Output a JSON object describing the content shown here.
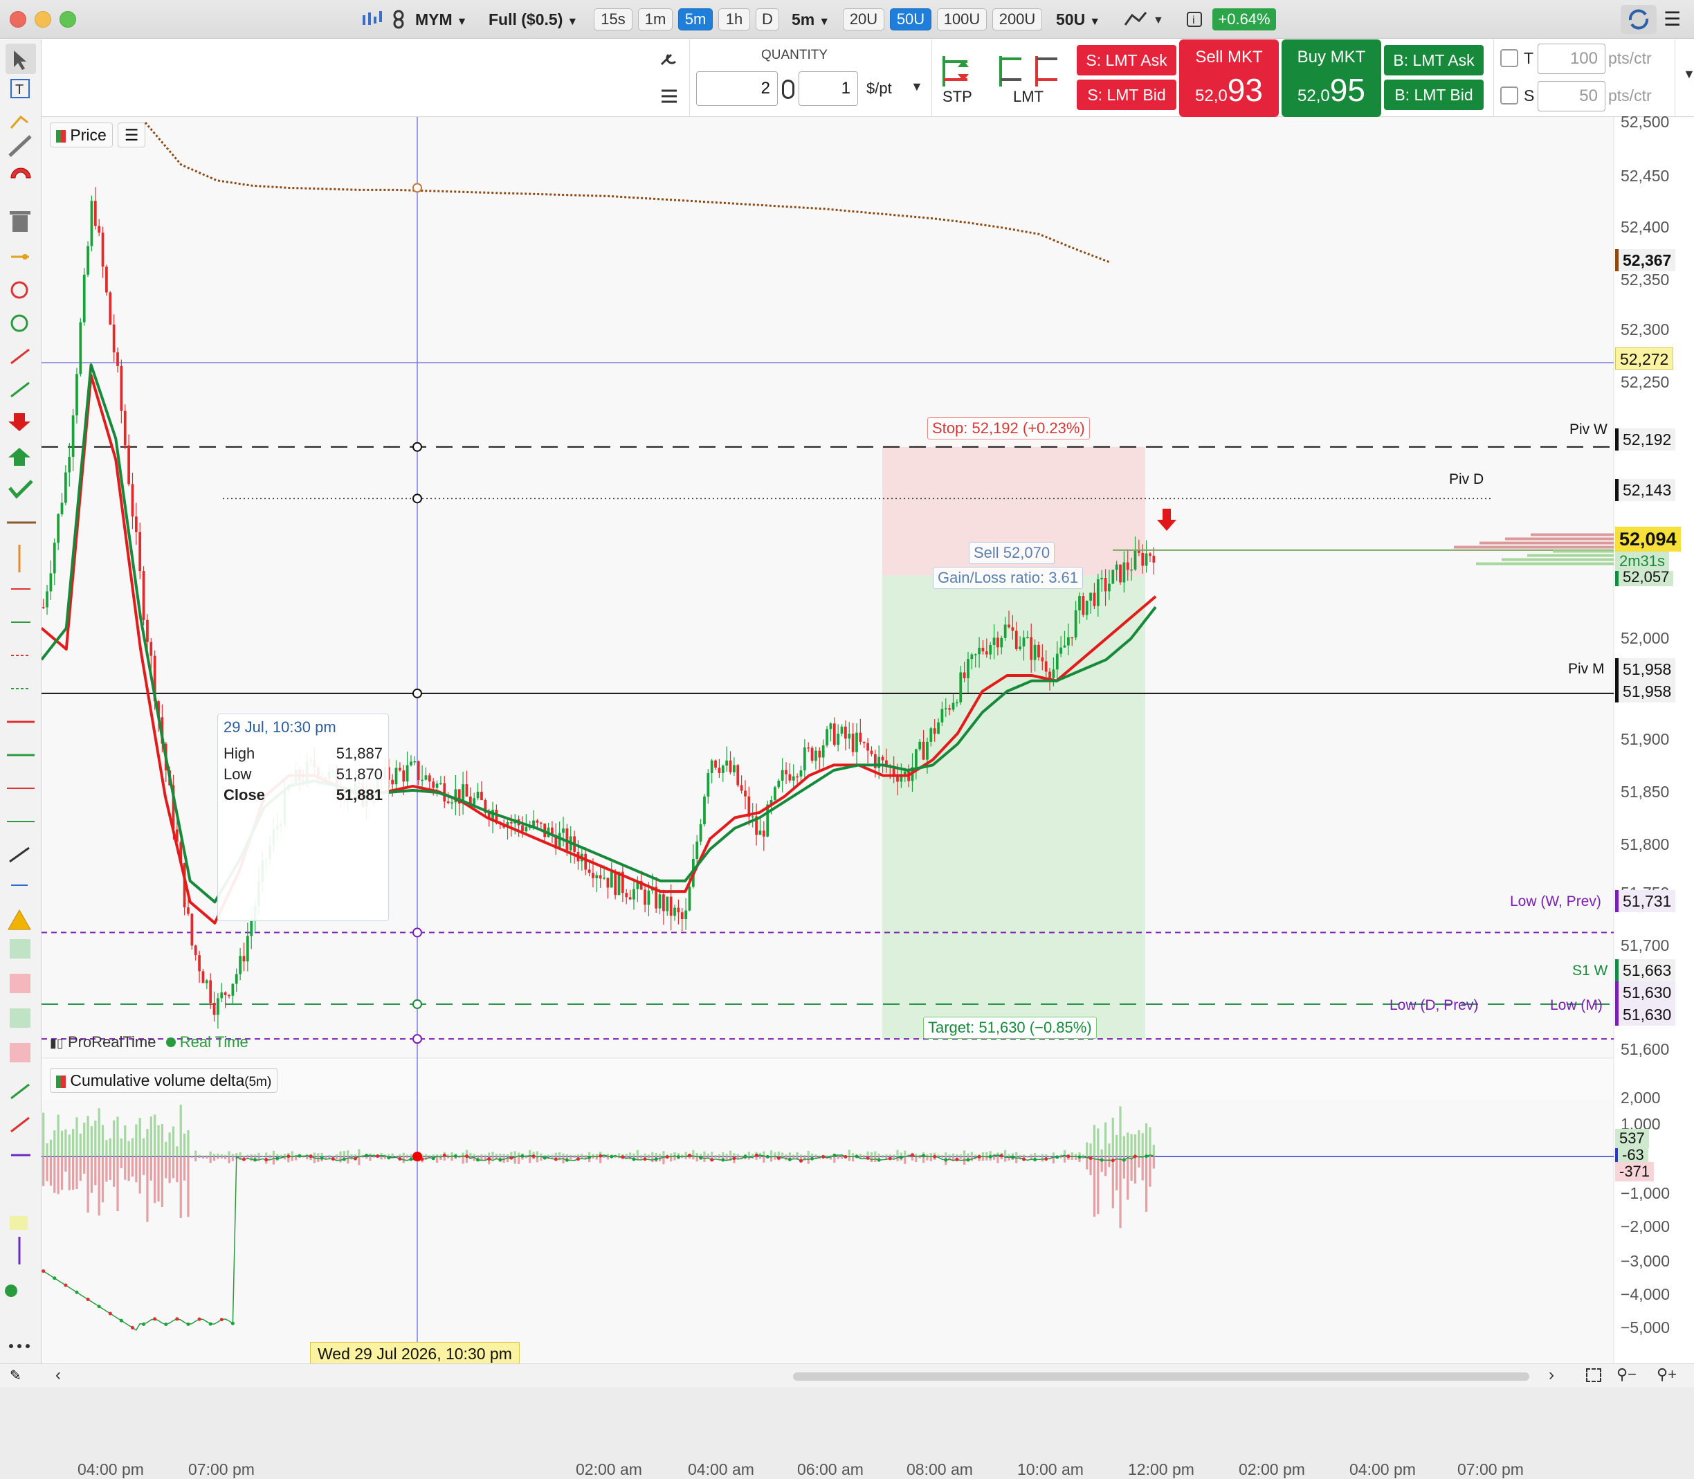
{
  "titlebar": {
    "symbol": "MYM",
    "contract": "Full ($0.5)",
    "timeframes": [
      {
        "label": "15s",
        "active": false
      },
      {
        "label": "1m",
        "active": false
      },
      {
        "label": "5m",
        "active": true
      },
      {
        "label": "1h",
        "active": false
      },
      {
        "label": "D",
        "active": false
      }
    ],
    "period_select": "5m",
    "units": [
      {
        "label": "20U",
        "active": false
      },
      {
        "label": "50U",
        "active": true
      },
      {
        "label": "100U",
        "active": false
      },
      {
        "label": "200U",
        "active": false
      }
    ],
    "units_select": "50U",
    "change": "+0.64%",
    "colors": {
      "change_bg": "#2ca44a",
      "active": "#1f7ed9"
    }
  },
  "orderbar": {
    "quantity_label": "QUANTITY",
    "qty_left": "2",
    "qty_right": "1",
    "per_point": "$/pt",
    "stp_label": "STP",
    "lmt_label": "LMT",
    "s_lmt_ask": "S: LMT Ask",
    "s_lmt_bid": "S: LMT Bid",
    "sell_mkt": "Sell MKT",
    "sell_prefix": "52,0",
    "sell_big": "93",
    "buy_mkt": "Buy MKT",
    "buy_prefix": "52,0",
    "buy_big": "95",
    "b_lmt_ask": "B: LMT Ask",
    "b_lmt_bid": "B: LMT Bid",
    "t_label": "T",
    "t_value": "100",
    "t_unit": "pts/ctr",
    "s_label": "S",
    "s_value": "50",
    "s_unit": "pts/ctr"
  },
  "chart": {
    "price_btn": "Price",
    "source": "ProRealTime",
    "realtime": "Real Time",
    "indicator": "Cumulative volume delta",
    "indicator_period": "(5m)",
    "tooltip": {
      "date": "29 Jul, 10:30 pm",
      "high_label": "High",
      "high": "51,887",
      "low_label": "Low",
      "low": "51,870",
      "close_label": "Close",
      "close": "51,881"
    },
    "stop_label": "Stop: 52,192 (+0.23%)",
    "target_label": "Target: 51,630 (−0.85%)",
    "sell_label": "Sell 52,070",
    "gain_loss": "Gain/Loss ratio: 3.61",
    "countdown": "2m31s",
    "crosshair_date": "Wed 29 Jul 2026, 10:30 pm",
    "levels": {
      "piv_w": "Piv W",
      "piv_d": "Piv D",
      "piv_m": "Piv M",
      "low_w_prev": "Low (W, Prev)",
      "s1_w": "S1 W",
      "low_d_prev": "Low (D, Prev)",
      "low_m": "Low (M)"
    },
    "price_axis": [
      "52,500",
      "52,450",
      "52,400",
      "52,350",
      "52,300",
      "52,250",
      "52,000",
      "51,900",
      "51,850",
      "51,800",
      "51,750",
      "51,700",
      "51,600"
    ],
    "price_tags": {
      "p52367": "52,367",
      "p52272": "52,272",
      "p52192": "52,192",
      "p52143": "52,143",
      "p52094": "52,094",
      "p52057": "52,057",
      "p51958a": "51,958",
      "p51958b": "51,958",
      "p51731": "51,731",
      "p51663": "51,663",
      "p51630a": "51,630",
      "p51630b": "51,630"
    },
    "cvd_axis": [
      "2,000",
      "1,000",
      "−1,000",
      "−2,000",
      "−3,000",
      "−4,000",
      "−5,000"
    ],
    "cvd_tags": {
      "a": "537",
      "b": "-63",
      "c": "-371"
    },
    "time_axis": [
      "04:00 pm",
      "07:00 pm",
      "02:00 am",
      "04:00 am",
      "06:00 am",
      "08:00 am",
      "10:00 am",
      "12:00 pm",
      "02:00 pm",
      "04:00 pm",
      "07:00 pm"
    ]
  },
  "chart_data": {
    "type": "candlestick",
    "symbol": "MYM",
    "interval": "5m",
    "ylim": [
      51580,
      52520
    ],
    "x_labels": [
      "04:00 pm",
      "07:00 pm",
      "02:00 am",
      "04:00 am",
      "06:00 am",
      "08:00 am",
      "10:00 am",
      "12:00 pm",
      "02:00 pm",
      "04:00 pm",
      "07:00 pm"
    ],
    "close_path": [
      52040,
      52180,
      52430,
      52260,
      52050,
      51880,
      51720,
      51660,
      51700,
      51800,
      51870,
      51890,
      51870,
      51860,
      51880,
      51885,
      51870,
      51860,
      51850,
      51835,
      51830,
      51820,
      51800,
      51780,
      51770,
      51760,
      51740,
      51900,
      51880,
      51820,
      51880,
      51900,
      51920,
      51910,
      51890,
      51880,
      51920,
      51960,
      52000,
      52020,
      52000,
      51980,
      52040,
      52060,
      52080,
      52094
    ],
    "ema_red": [
      52020,
      52000,
      52260,
      52180,
      52000,
      51860,
      51760,
      51740,
      51790,
      51860,
      51880,
      51880,
      51870,
      51860,
      51865,
      51870,
      51865,
      51855,
      51840,
      51830,
      51820,
      51810,
      51800,
      51790,
      51780,
      51770,
      51770,
      51820,
      51840,
      51845,
      51860,
      51880,
      51890,
      51890,
      51880,
      51880,
      51895,
      51920,
      51960,
      51975,
      51975,
      51970,
      51990,
      52010,
      52030,
      52050
    ],
    "ema_green": [
      51990,
      52020,
      52270,
      52200,
      52030,
      51900,
      51780,
      51760,
      51800,
      51850,
      51870,
      51875,
      51870,
      51862,
      51864,
      51866,
      51864,
      51856,
      51846,
      51838,
      51830,
      51820,
      51810,
      51800,
      51790,
      51780,
      51780,
      51810,
      51830,
      51840,
      51855,
      51870,
      51885,
      51890,
      51890,
      51885,
      51890,
      51910,
      51940,
      51960,
      51970,
      51970,
      51980,
      51990,
      52010,
      52040
    ],
    "vwap": [
      52500,
      52460,
      52445,
      52440,
      52438,
      52437,
      52436,
      52436,
      52435,
      52434,
      52433,
      52432,
      52431,
      52430,
      52428,
      52426,
      52424,
      52422,
      52420,
      52418,
      52415,
      52412,
      52409,
      52405,
      52400,
      52394,
      52380,
      52367
    ],
    "levels": {
      "piv_w": 52192,
      "piv_d": 52143,
      "piv_m": 51958,
      "low_w_prev": 51731,
      "s1_w": 51663,
      "low_d_prev": 51630,
      "low_m": 51630,
      "line_52272": 52272
    },
    "position": {
      "side": "sell",
      "entry": 52070,
      "stop": 52192,
      "target": 51630,
      "gain_loss_ratio": 3.61
    },
    "last_price": 52094,
    "cvd": {
      "ylim": [
        -5300,
        2300
      ],
      "ticks": [
        2000,
        1000,
        0,
        -1000,
        -2000,
        -3000,
        -4000,
        -5000
      ],
      "last": [
        537,
        -63,
        -371
      ]
    }
  }
}
